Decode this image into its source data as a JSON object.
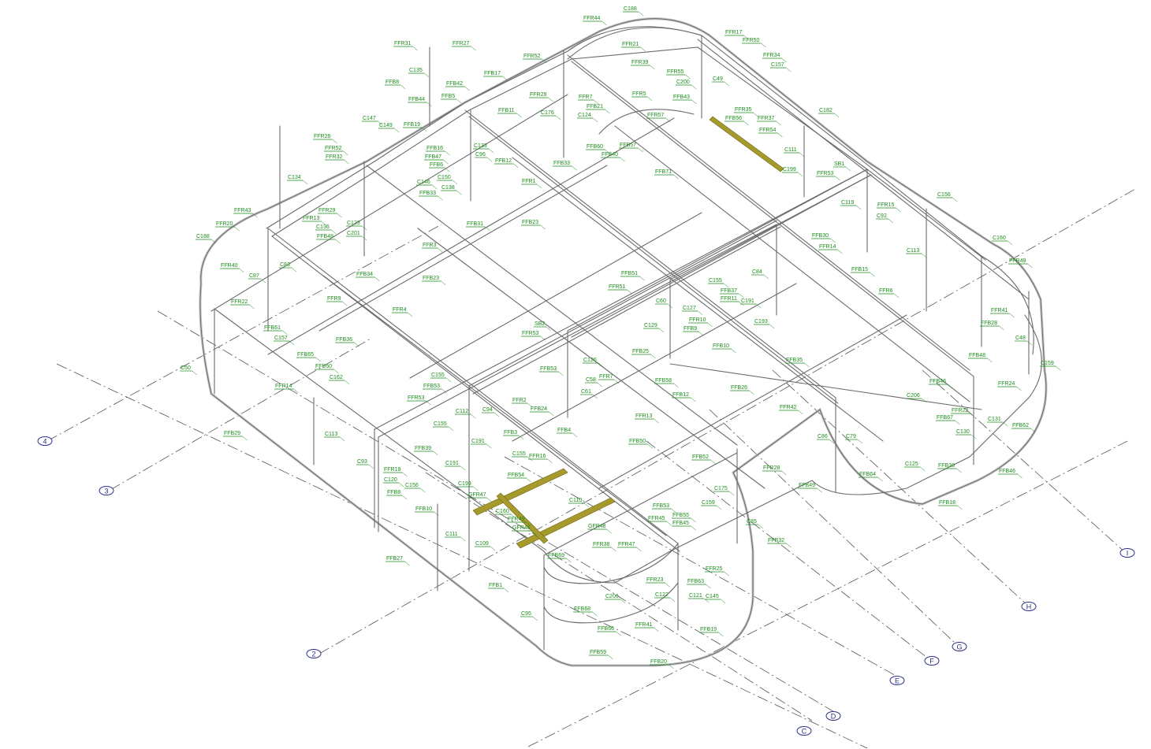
{
  "grid_axes": [
    "2",
    "3",
    "4",
    "C",
    "D",
    "E",
    "F",
    "G",
    "H",
    "I"
  ],
  "member_tags": [
    "C188",
    "FFR44",
    "FFR17",
    "FFR50",
    "FFR21",
    "FFR39",
    "FFR31",
    "FFR27",
    "FFR52",
    "FFR34",
    "C157",
    "C135",
    "FFB17",
    "FFB8",
    "FFB42",
    "FFB5",
    "FFR55",
    "C200",
    "C49",
    "FFR29",
    "FFB44",
    "FFR5",
    "FFB43",
    "FFR7",
    "FFB21",
    "FFB11",
    "C176",
    "C124",
    "FFR57",
    "FFR35",
    "FFB56",
    "FFR37",
    "C182",
    "FFB19",
    "C147",
    "C149",
    "FFR26",
    "FFB16",
    "C133",
    "FFB60",
    "FFB57",
    "FFR54",
    "FFR52",
    "FFB47",
    "FFR32",
    "FFB6",
    "C96",
    "FFB12",
    "FFB40",
    "FFB33",
    "C111",
    "FFB71",
    "C199",
    "FFR53",
    "SB1",
    "C134",
    "C146",
    "C150",
    "C138",
    "FFR1",
    "C156",
    "FFB33",
    "FFR15",
    "C119",
    "C92",
    "FFR43",
    "FFR29",
    "FFR20",
    "FFR13",
    "C123",
    "C136",
    "FFB48",
    "C201",
    "FFB31",
    "FFB23",
    "C188",
    "FFR3",
    "FFB30",
    "FFR14",
    "C113",
    "C160",
    "FFR49",
    "FFR40",
    "C83",
    "C87",
    "FFB34",
    "FFB23",
    "FFB51",
    "FFR51",
    "C155",
    "C84",
    "FFB15",
    "FFR22",
    "FFR9",
    "FFR4",
    "C60",
    "C127",
    "FFB37",
    "FFR11",
    "C191",
    "FFR6",
    "FFR41",
    "FFB61",
    "SB2",
    "FFR53",
    "C129",
    "FFB9",
    "FFR10",
    "C193",
    "FFB28",
    "C157",
    "FFB36",
    "FFB65",
    "FFB25",
    "FFB10",
    "C48",
    "C50",
    "FFB50",
    "C162",
    "C126",
    "FFB53",
    "FFB35",
    "FFB48",
    "C159",
    "FFR14",
    "C155",
    "FFB53",
    "C58",
    "C61",
    "FFR7",
    "FFB58",
    "FFR24",
    "FFB46",
    "FFB29",
    "FFR53",
    "FFR2",
    "FFB24",
    "FFB12",
    "FFB26",
    "C206",
    "FFR22",
    "FFR42",
    "FFB67",
    "C131",
    "FFB62",
    "C113",
    "C155",
    "FFR13",
    "C130",
    "C112",
    "C94",
    "C191",
    "FFB3",
    "FFB4",
    "FFB50",
    "C86",
    "C79",
    "C93",
    "FFB39",
    "C155",
    "FFR16",
    "FFB52",
    "FFR28",
    "C125",
    "FFB38",
    "FFB46",
    "FFR19",
    "C191",
    "FFB54",
    "C120",
    "C156",
    "C193",
    "FFB64",
    "C175",
    "FFB49",
    "FFB18",
    "FFB8",
    "GFR47",
    "C110",
    "C160",
    "FFB10",
    "FFR49",
    "GFR46",
    "GFR48",
    "C159",
    "FFB53",
    "FFR45",
    "FFB55",
    "FFB45",
    "C85",
    "FFB32",
    "C111",
    "C109",
    "FFR38",
    "FFR47",
    "FFB69",
    "FFB27",
    "FFR25",
    "FFB1",
    "FFR23",
    "FFB63",
    "C206",
    "C122",
    "C121",
    "C145",
    "C95",
    "FFB68",
    "FFB66",
    "FFR41",
    "FFB19",
    "FFB59",
    "FFB20"
  ],
  "colors": {
    "tag": "#1a8c1a",
    "member": "#6b6b6b",
    "bubble": "#2a2f8a",
    "highlight": "#a79a2c"
  }
}
